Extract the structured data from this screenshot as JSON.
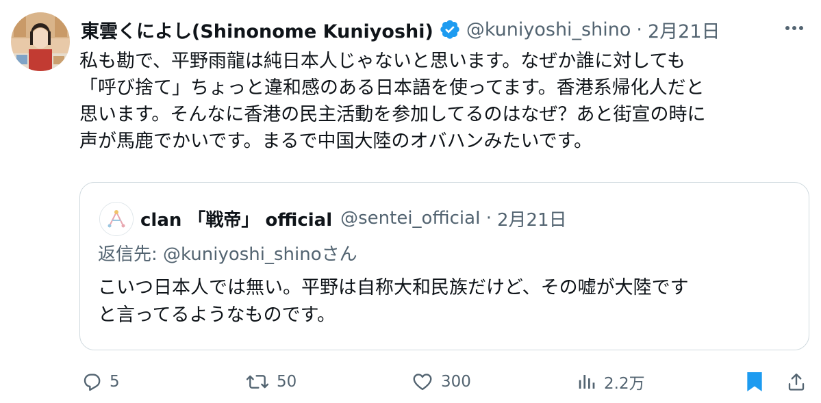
{
  "tweet": {
    "display_name": "東雲くによし(Shinonome Kuniyoshi)",
    "handle": "@kuniyoshi_shino",
    "separator": "·",
    "date": "2月21日",
    "body_lines": [
      "私も勘で、平野雨龍は純日本人じゃないと思います。なぜか誰に対しても",
      "「呼び捨て」ちょっと違和感のある日本語を使ってます。香港系帰化人だと",
      "思います。そんなに香港の民主活動を参加してるのはなぜ？あと街宣の時に",
      "声が馬鹿でかいです。まるで中国大陸のオバハンみたいです。"
    ],
    "verified_color": "#1d9bf0",
    "more_icon": "more-horizontal-icon"
  },
  "quote": {
    "display_name": "clan 「戦帝」 official",
    "handle": "@sentei_officiaI",
    "separator": "·",
    "date": "2月21日",
    "reply_to": "返信先: @kuniyoshi_shinoさん",
    "body_lines": [
      "こいつ日本人では無い。平野は自称大和民族だけど、その嘘が大陸です",
      "と言ってるようなものです。"
    ]
  },
  "actions": {
    "reply_count": "5",
    "retweet_count": "50",
    "like_count": "300",
    "view_count": "2.2万",
    "bookmark_color": "#1d9bf0",
    "icons": [
      "reply-icon",
      "retweet-icon",
      "like-icon",
      "views-icon",
      "bookmark-icon",
      "share-icon"
    ]
  }
}
